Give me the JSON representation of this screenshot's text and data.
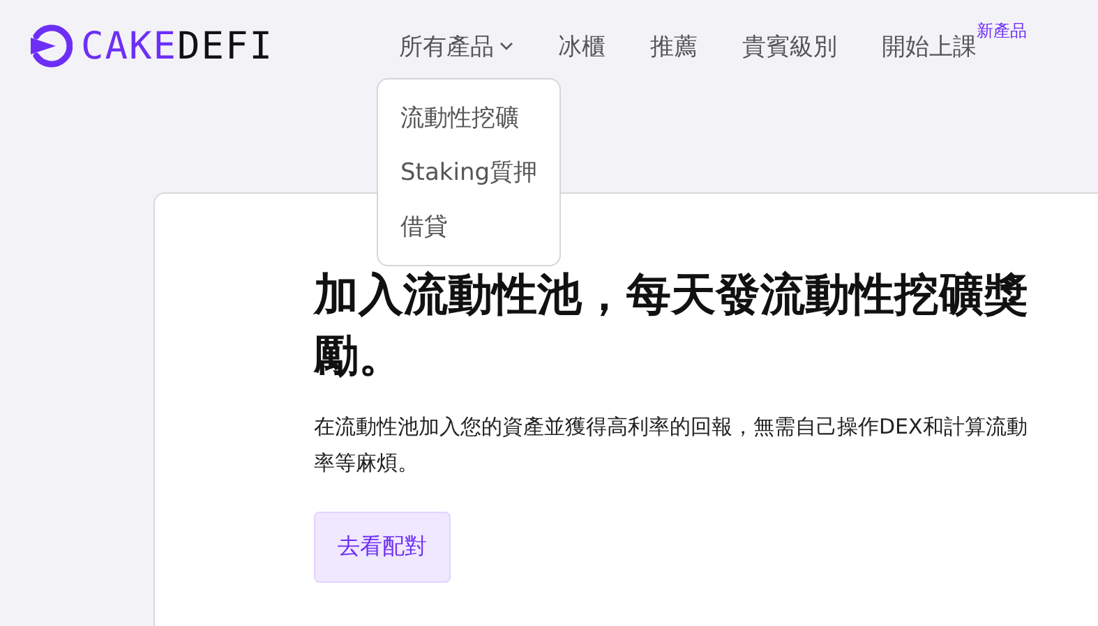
{
  "header": {
    "logo": {
      "part_1": "CAKE",
      "part_2": "DEFI"
    },
    "nav": [
      {
        "label": "所有產品",
        "kind": "dropdown",
        "expanded": true
      },
      {
        "label": "冰櫃",
        "kind": "link"
      },
      {
        "label": "推薦",
        "kind": "link"
      },
      {
        "label": "貴賓級別",
        "kind": "link"
      },
      {
        "label": "開始上課",
        "kind": "link",
        "badge": "新產品"
      }
    ],
    "dropdown": [
      "流動性挖礦",
      "Staking質押",
      "借貸"
    ]
  },
  "hero": {
    "heading_lines": [
      "加入流動性池，每天發流動性挖礦獎",
      "勵。"
    ],
    "description_lines": [
      "在流動性池加入您的資產並獲得高利率的回報，無需自己操作DEX和計算流動",
      "率等麻煩。"
    ],
    "button": "去看配對"
  }
}
